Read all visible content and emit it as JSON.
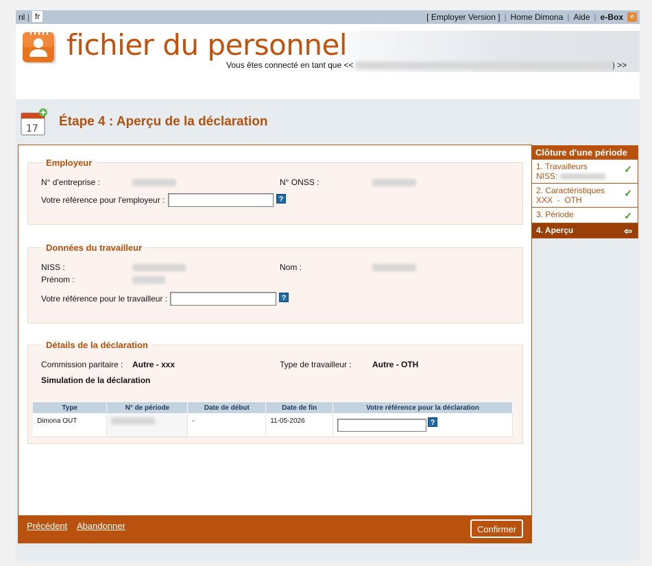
{
  "topbar": {
    "lang_nl": "nl",
    "lang_fr": "fr",
    "employer_version": "[ Employer Version ]",
    "home_dimona": "Home Dimona",
    "aide": "Aide",
    "ebox": "e-Box",
    "ebox_icon_glyph": "e"
  },
  "header": {
    "title": "fichier du personnel",
    "connected_prefix": "Vous êtes connecté en tant que <<",
    "connected_suffix": ") >>"
  },
  "step": {
    "title": "Étape 4 : Aperçu de la déclaration",
    "calendar_number": "17"
  },
  "employeur": {
    "legend": "Employeur",
    "entreprise_label": "N° d'entreprise :",
    "onss_label": "N° ONSS :",
    "ref_label": "Votre référence pour l'employeur :",
    "ref_value": ""
  },
  "travailleur": {
    "legend": "Données du travailleur",
    "niss_label": "NISS :",
    "prenom_label": "Prénom :",
    "nom_label": "Nom :",
    "ref_label": "Votre référence pour le travailleur :",
    "ref_value": ""
  },
  "details": {
    "legend": "Détails de la déclaration",
    "commission_label": "Commission paritaire :",
    "commission_value": "Autre - xxx",
    "type_label": "Type de travailleur :",
    "type_value": "Autre - OTH",
    "simulation": "Simulation de la déclaration",
    "table": {
      "headers": [
        "Type",
        "N° de période",
        "Date de début",
        "Date de fin",
        "Votre référence pour la déclaration"
      ],
      "rows": [
        {
          "type": "Dimona OUT",
          "periode": "",
          "debut": "-",
          "fin": "11-05-2026",
          "ref": ""
        }
      ]
    }
  },
  "footer": {
    "precedent": "Précédent",
    "abandonner": "Abandonner",
    "confirmer": "Confirmer"
  },
  "side": {
    "title": "Clôture d'une période",
    "items": [
      {
        "line1": "1. Travailleurs",
        "line2": "NISS:"
      },
      {
        "line1": "2. Caractéristiques",
        "line2": "XXX  -  OTH"
      },
      {
        "line1": "3. Période",
        "line2": ""
      },
      {
        "line1": "4. Aperçu",
        "line2": ""
      }
    ],
    "check_glyph": "✓",
    "arrow_glyph": "⇦"
  },
  "colors": {
    "accent": "#b8520e",
    "topbar": "#b9c6d6",
    "band": "#e7ecf1"
  },
  "icons": [
    "personnel-logo-icon",
    "calendar-add-icon",
    "help-icon",
    "check-icon",
    "back-arrow-icon",
    "ebox-icon"
  ]
}
